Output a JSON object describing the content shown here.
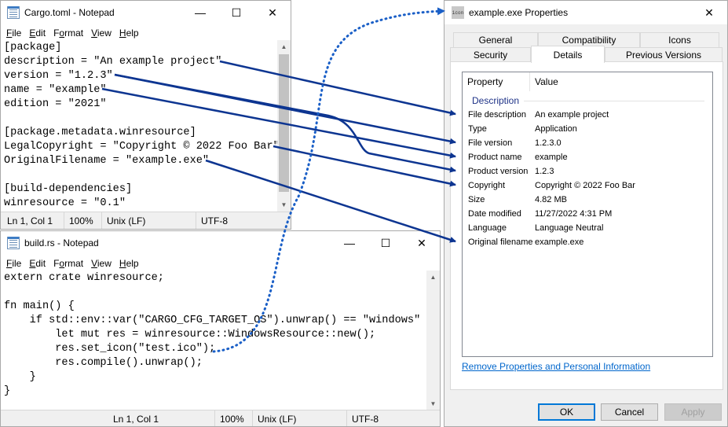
{
  "cargo_window": {
    "title": "Cargo.toml - Notepad",
    "menu": [
      {
        "label": "File",
        "accel": "F"
      },
      {
        "label": "Edit",
        "accel": "E"
      },
      {
        "label": "Format",
        "accel": "o"
      },
      {
        "label": "View",
        "accel": "V"
      },
      {
        "label": "Help",
        "accel": "H"
      }
    ],
    "lines": [
      "[package]",
      "description = \"An example project\"",
      "version = \"1.2.3\"",
      "name = \"example\"",
      "edition = \"2021\"",
      "",
      "[package.metadata.winresource]",
      "LegalCopyright = \"Copyright © 2022 Foo Bar\"",
      "OriginalFilename = \"example.exe\"",
      "",
      "[build-dependencies]",
      "winresource = \"0.1\""
    ],
    "status": {
      "position": "Ln 1, Col 1",
      "zoom": "100%",
      "line_ending": "Unix (LF)",
      "encoding": "UTF-8"
    }
  },
  "build_window": {
    "title": "build.rs - Notepad",
    "menu": [
      {
        "label": "File",
        "accel": "F"
      },
      {
        "label": "Edit",
        "accel": "E"
      },
      {
        "label": "Format",
        "accel": "o"
      },
      {
        "label": "View",
        "accel": "V"
      },
      {
        "label": "Help",
        "accel": "H"
      }
    ],
    "lines": [
      "extern crate winresource;",
      "",
      "fn main() {",
      "    if std::env::var(\"CARGO_CFG_TARGET_OS\").unwrap() == \"windows\" {",
      "        let mut res = winresource::WindowsResource::new();",
      "        res.set_icon(\"test.ico\");",
      "        res.compile().unwrap();",
      "    }",
      "}"
    ],
    "status": {
      "position": "Ln 1, Col 1",
      "zoom": "100%",
      "line_ending": "Unix (LF)",
      "encoding": "UTF-8"
    }
  },
  "properties_dialog": {
    "title": "example.exe Properties",
    "icon_label": "icon",
    "tabs_back": [
      "General",
      "Compatibility",
      "Icons"
    ],
    "tabs_front": [
      "Security",
      "Details",
      "Previous Versions"
    ],
    "active_tab": "Details",
    "columns": [
      "Property",
      "Value"
    ],
    "group": "Description",
    "rows": [
      {
        "property": "File description",
        "value": "An example project"
      },
      {
        "property": "Type",
        "value": "Application"
      },
      {
        "property": "File version",
        "value": "1.2.3.0"
      },
      {
        "property": "Product name",
        "value": "example"
      },
      {
        "property": "Product version",
        "value": "1.2.3"
      },
      {
        "property": "Copyright",
        "value": "Copyright © 2022 Foo Bar"
      },
      {
        "property": "Size",
        "value": "4.82 MB"
      },
      {
        "property": "Date modified",
        "value": "11/27/2022 4:31 PM"
      },
      {
        "property": "Language",
        "value": "Language Neutral"
      },
      {
        "property": "Original filename",
        "value": "example.exe"
      }
    ],
    "remove_link": "Remove Properties and Personal Information",
    "buttons": {
      "ok": "OK",
      "cancel": "Cancel",
      "apply": "Apply"
    }
  },
  "annotation": {
    "arrow_color": "#0d3591",
    "dotted_color": "#1a5fc7"
  }
}
